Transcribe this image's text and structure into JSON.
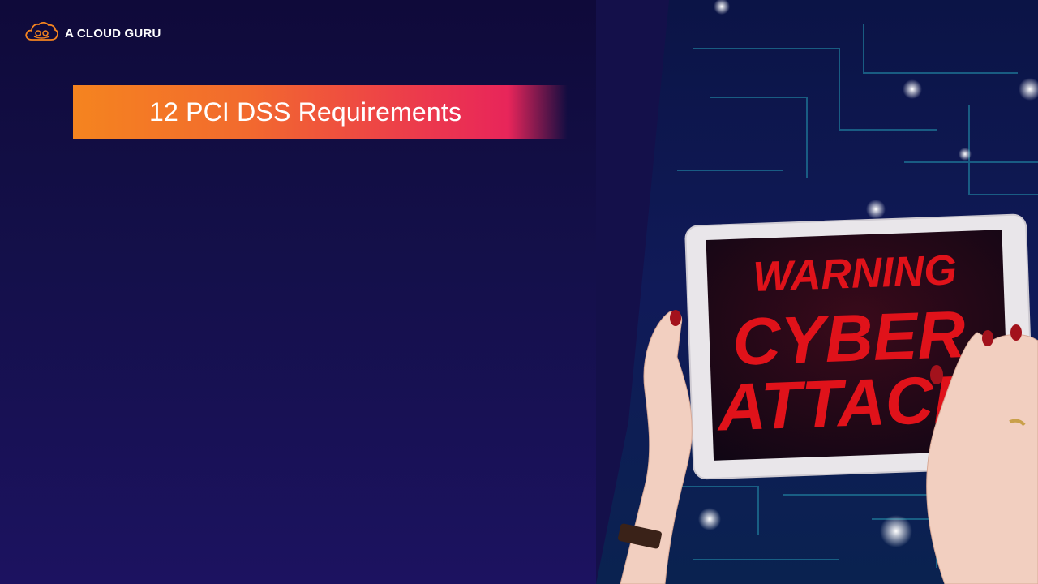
{
  "brand": {
    "name": "A CLOUD GURU",
    "logo_icon": "cloud-logo-icon",
    "accent": "#f5841f"
  },
  "slide": {
    "title": "12 PCI DSS Requirements",
    "banner_colors": [
      "#f5841f",
      "#e8255a"
    ],
    "background": "#14104a"
  },
  "hero_image": {
    "screen_lines": [
      "WARNING",
      "CYBER",
      "ATTACK"
    ],
    "screen_text_color": "#e0121a"
  }
}
